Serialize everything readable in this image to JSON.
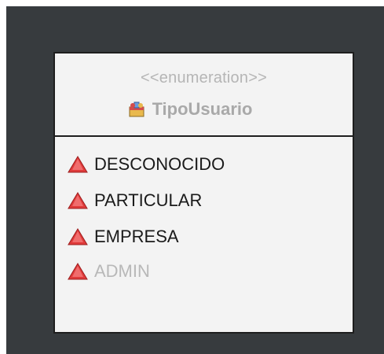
{
  "diagram": {
    "stereotype": "<<enumeration>>",
    "class_name": "TipoUsuario",
    "class_icon": "enumeration-class-icon",
    "literal_icon": "red-triangle-literal-icon",
    "literals": [
      {
        "label": "DESCONOCIDO",
        "disabled": false
      },
      {
        "label": "PARTICULAR",
        "disabled": false
      },
      {
        "label": "EMPRESA",
        "disabled": false
      },
      {
        "label": "ADMIN",
        "disabled": true
      }
    ]
  },
  "colors": {
    "canvas": "#373b3e",
    "box_fill": "#f3f3f3",
    "border": "#1e1e1e",
    "muted_text": "#b5b5b5",
    "literal_icon": "#e03b3b"
  }
}
